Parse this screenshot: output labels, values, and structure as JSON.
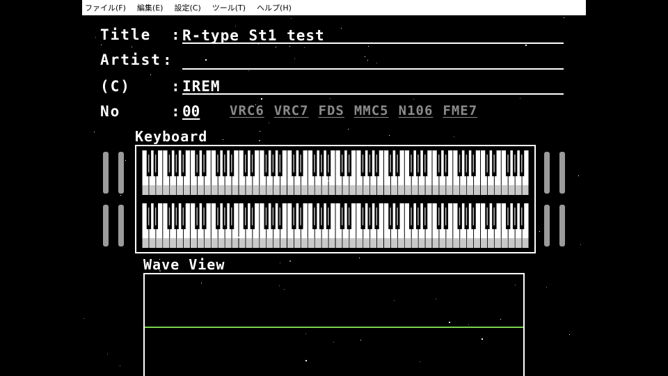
{
  "menu": [
    {
      "id": "file",
      "label": "ファイル(F)"
    },
    {
      "id": "edit",
      "label": "編集(E)"
    },
    {
      "id": "settings",
      "label": "設定(C)"
    },
    {
      "id": "tools",
      "label": "ツール(T)"
    },
    {
      "id": "help",
      "label": "ヘルプ(H)"
    }
  ],
  "song_info": {
    "title_label": "Title",
    "title_value": "R-type St1 test",
    "artist_label": "Artist",
    "artist_value": "",
    "copyright_label": "(C)",
    "copyright_value": "IREM",
    "no_label": "No",
    "colon": ":",
    "no_value": "00"
  },
  "chips": [
    "VRC6",
    "VRC7",
    "FDS",
    "MMC5",
    "N106",
    "FME7"
  ],
  "keyboard": {
    "title": "Keyboard",
    "rows": 2,
    "octaves_per_row": 8
  },
  "wave_view": {
    "title": "Wave View",
    "line_color": "#7bd34f"
  },
  "colors": {
    "background": "#000000",
    "text": "#ffffff",
    "chip_inactive": "#8a8a8a",
    "volume_bar": "#9a9a9a"
  }
}
